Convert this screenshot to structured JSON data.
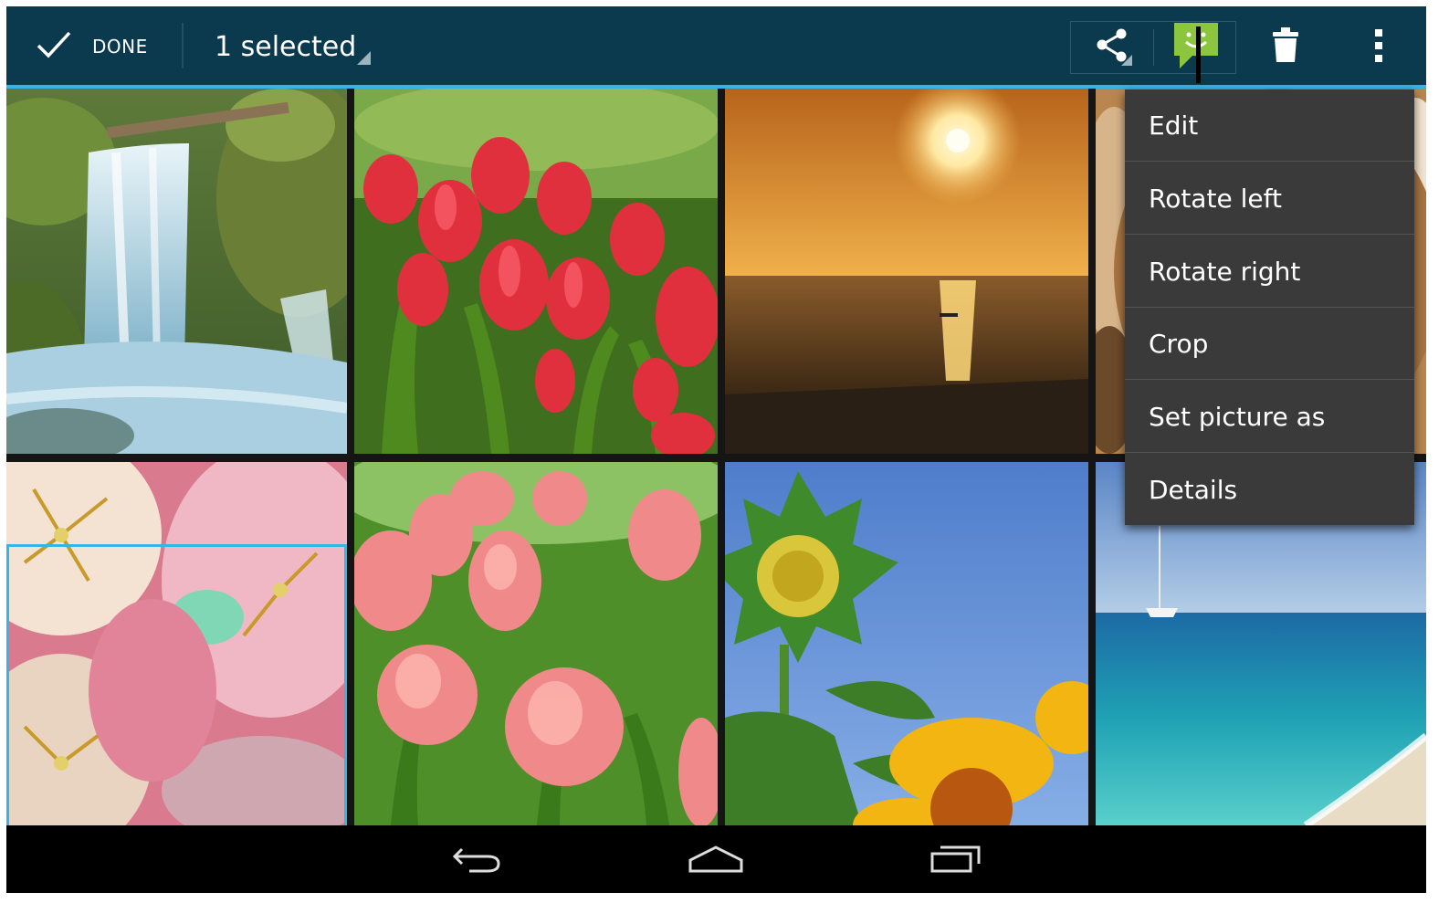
{
  "action_bar": {
    "done_label": "DONE",
    "selection_label": "1 selected",
    "icons": {
      "done": "checkmark-icon",
      "share": "share-icon",
      "messaging": "messaging-app-icon",
      "delete": "trash-icon",
      "overflow": "overflow-menu-icon"
    },
    "colors": {
      "bar": "#0b3a4f",
      "accent": "#33b5e5"
    }
  },
  "grid": {
    "photos": [
      {
        "subject": "waterfall"
      },
      {
        "subject": "red tulips"
      },
      {
        "subject": "sunset over sea"
      },
      {
        "subject": "tabby cat"
      },
      {
        "subject": "pink tulip close-up",
        "selected": true
      },
      {
        "subject": "pink tulips"
      },
      {
        "subject": "sunflower bud"
      },
      {
        "subject": "sailboat at beach"
      }
    ]
  },
  "overflow_menu": {
    "items": [
      {
        "label": "Edit"
      },
      {
        "label": "Rotate left"
      },
      {
        "label": "Rotate right"
      },
      {
        "label": "Crop"
      },
      {
        "label": "Set picture as"
      },
      {
        "label": "Details"
      }
    ]
  },
  "nav_bar": {
    "icons": {
      "back": "back-icon",
      "home": "home-icon",
      "recents": "recent-apps-icon"
    }
  }
}
